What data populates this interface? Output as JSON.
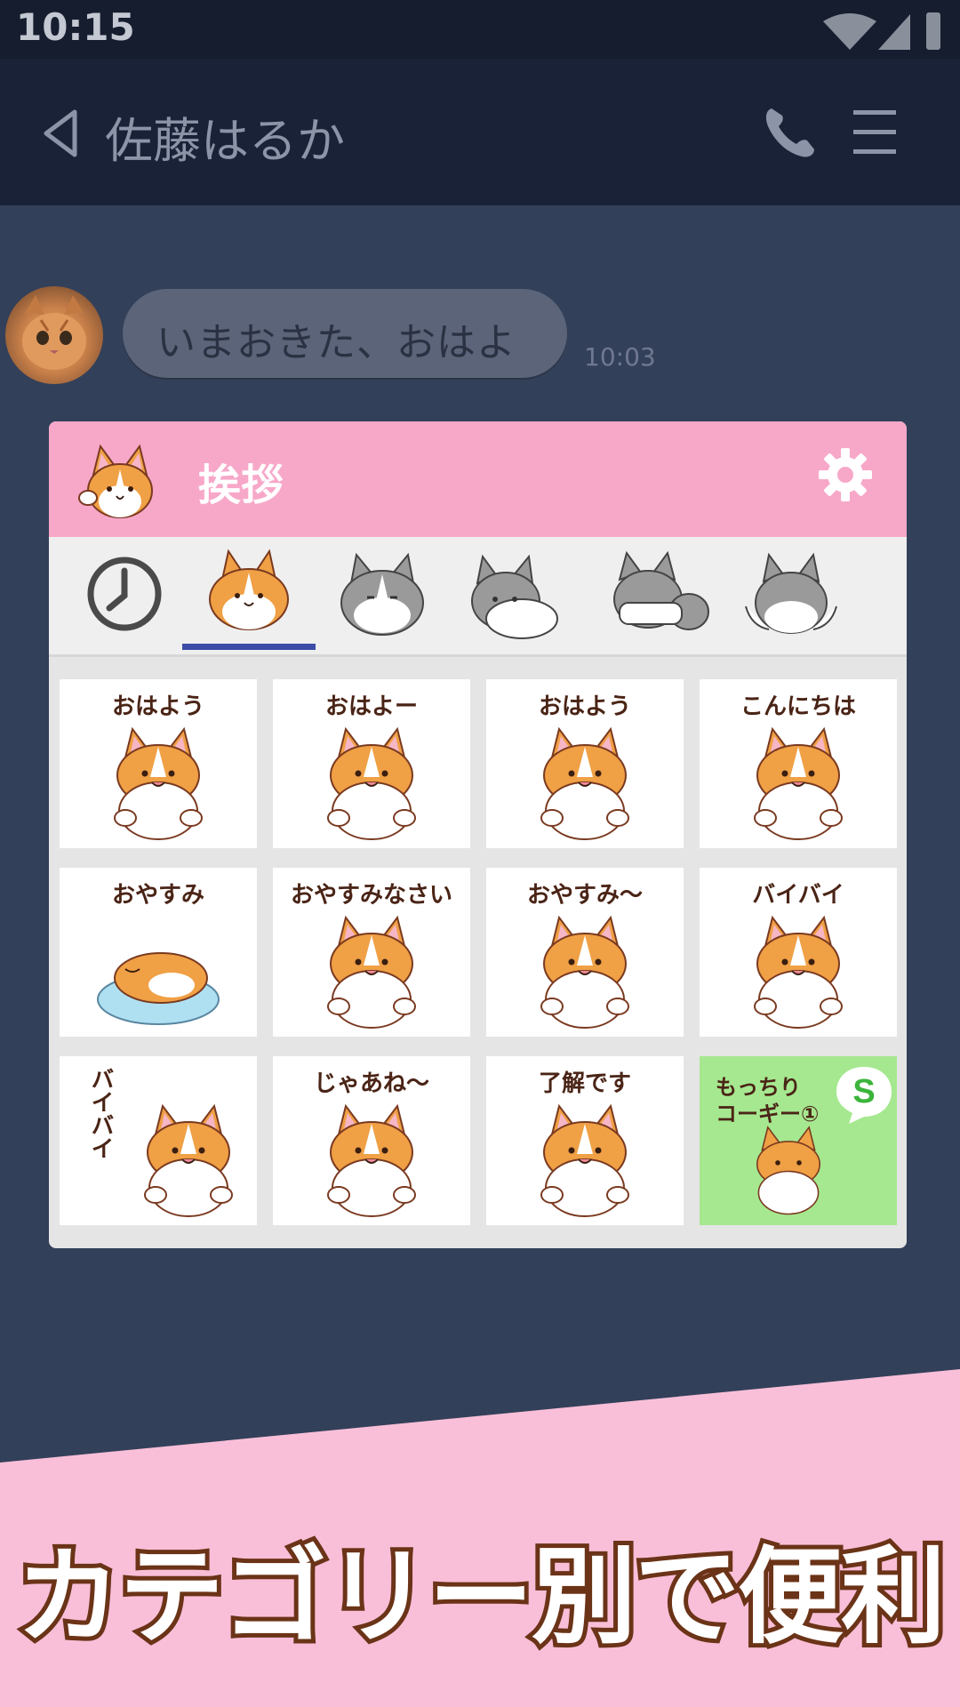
{
  "status_bar": {
    "time": "10:15"
  },
  "header": {
    "contact_name": "佐藤はるか"
  },
  "chat": {
    "messages": [
      {
        "text": "いまおきた、おはよ",
        "time": "10:03"
      }
    ]
  },
  "sticker_panel": {
    "category_title": "挨拶",
    "tabs": [
      {
        "name": "recent",
        "icon": "clock-icon"
      },
      {
        "name": "corgi-orange",
        "selected": true
      },
      {
        "name": "corgi-gray-1"
      },
      {
        "name": "corgi-gray-2"
      },
      {
        "name": "corgi-gray-3"
      },
      {
        "name": "corgi-gray-4"
      }
    ],
    "stickers": [
      {
        "label": "おはよう"
      },
      {
        "label": "おはよー"
      },
      {
        "label": "おはよう"
      },
      {
        "label": "こんにちは"
      },
      {
        "label": "おやすみ"
      },
      {
        "label": "おやすみなさい"
      },
      {
        "label": "おやすみ〜"
      },
      {
        "label": "バイバイ"
      },
      {
        "label": "バイバイ"
      },
      {
        "label": "じゃあね〜"
      },
      {
        "label": "了解です"
      }
    ],
    "promo": {
      "line1": "もっちり",
      "line2": "コーギー①",
      "badge": "S"
    }
  },
  "banner": {
    "text": "カテゴリー別で便利"
  },
  "colors": {
    "background": "#334059",
    "header_bg": "#1a2237",
    "panel_header": "#f7a8c9",
    "tab_indicator": "#3d4ca6",
    "banner": "#f9bfd9",
    "promo_bg": "#a6e890",
    "corgi_orange": "#f0a045"
  }
}
